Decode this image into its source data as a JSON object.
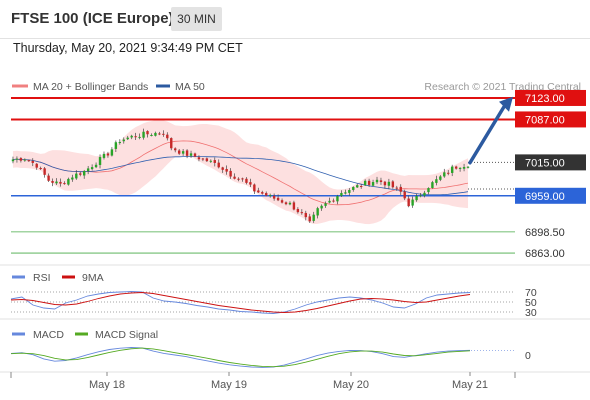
{
  "header": {
    "instrument": "FTSE 100 (ICE Europe)",
    "timeframe": "30 MIN",
    "datetime": "Thursday, May 20, 2021 9:34:49 PM CET"
  },
  "colors": {
    "resistance": "#e01010",
    "support": "#2c64d8",
    "pivot": "#333333",
    "green_level": "#44aa44",
    "band_fill": "#fde0e0",
    "ma20": "#f07070",
    "ma50": "#3060b0",
    "arrow": "#2c5aa0",
    "rsi": "#6688dd",
    "rsi_ma": "#cc1111",
    "macd": "#6688dd",
    "macd_signal": "#55aa22"
  },
  "chart_data": [
    {
      "type": "candlestick",
      "legend": [
        {
          "label": "MA 20 + Bollinger Bands",
          "color": "#f08080"
        },
        {
          "label": "MA 50",
          "color": "#2b5aa0"
        }
      ],
      "copyright": "Research © 2021 Trading Central",
      "ylim": [
        6848,
        7133
      ],
      "x_ticks": [
        "May 18",
        "May 19",
        "May 20",
        "May 21"
      ],
      "levels": [
        {
          "label": "7123.00",
          "value": 7123,
          "kind": "resistance"
        },
        {
          "label": "7087.00",
          "value": 7087,
          "kind": "resistance"
        },
        {
          "label": "7015.00",
          "value": 7015,
          "kind": "pivot"
        },
        {
          "label": "6959.00",
          "value": 6959,
          "kind": "support"
        },
        {
          "label": "6898.50",
          "value": 6898.5,
          "kind": "minor"
        },
        {
          "label": "6863.00",
          "value": 6863,
          "kind": "minor"
        }
      ],
      "anchors": [
        [
          0,
          7020
        ],
        [
          3,
          7022
        ],
        [
          6,
          7010
        ],
        [
          9,
          6985
        ],
        [
          12,
          6978
        ],
        [
          15,
          6992
        ],
        [
          18,
          7000
        ],
        [
          21,
          7015
        ],
        [
          24,
          7030
        ],
        [
          27,
          7052
        ],
        [
          30,
          7058
        ],
        [
          33,
          7062
        ],
        [
          36,
          7064
        ],
        [
          38,
          7066
        ],
        [
          40,
          7040
        ],
        [
          43,
          7030
        ],
        [
          46,
          7025
        ],
        [
          49,
          7018
        ],
        [
          52,
          7010
        ],
        [
          55,
          6995
        ],
        [
          58,
          6985
        ],
        [
          61,
          6968
        ],
        [
          64,
          6960
        ],
        [
          67,
          6952
        ],
        [
          70,
          6945
        ],
        [
          73,
          6928
        ],
        [
          75,
          6912
        ],
        [
          77,
          6935
        ],
        [
          80,
          6950
        ],
        [
          83,
          6965
        ],
        [
          86,
          6972
        ],
        [
          89,
          6980
        ],
        [
          92,
          6985
        ],
        [
          95,
          6978
        ],
        [
          98,
          6965
        ],
        [
          100,
          6945
        ],
        [
          102,
          6955
        ],
        [
          105,
          6975
        ],
        [
          108,
          6990
        ],
        [
          111,
          7005
        ],
        [
          113,
          7010
        ],
        [
          115,
          7012
        ]
      ],
      "candle_count": 116
    },
    {
      "type": "line",
      "name": "RSI",
      "legend": [
        {
          "label": "RSI",
          "color": "#6688dd"
        },
        {
          "label": "9MA",
          "color": "#cc1111"
        }
      ],
      "levels": [
        70,
        50,
        30
      ],
      "level_labels": [
        "70",
        "50",
        "30"
      ],
      "ylim": [
        20,
        80
      ],
      "series": [
        {
          "name": "RSI",
          "values": [
            56,
            60,
            44,
            38,
            36,
            48,
            54,
            62,
            66,
            69,
            70,
            71,
            70,
            58,
            52,
            50,
            47,
            43,
            40,
            36,
            34,
            31,
            30,
            28,
            27,
            30,
            36,
            44,
            50,
            54,
            58,
            60,
            58,
            54,
            48,
            40,
            38,
            46,
            58,
            64,
            66,
            68,
            69
          ]
        },
        {
          "name": "9MA",
          "values": [
            54,
            55,
            53,
            49,
            45,
            44,
            46,
            51,
            57,
            62,
            66,
            68,
            69,
            67,
            63,
            59,
            55,
            51,
            47,
            43,
            40,
            37,
            34,
            32,
            30,
            29,
            30,
            33,
            37,
            42,
            47,
            52,
            56,
            57,
            56,
            54,
            51,
            49,
            50,
            54,
            58,
            62,
            65
          ]
        }
      ]
    },
    {
      "type": "line",
      "name": "MACD",
      "legend": [
        {
          "label": "MACD",
          "color": "#6688dd"
        },
        {
          "label": "MACD Signal",
          "color": "#55aa22"
        }
      ],
      "levels": [
        0
      ],
      "level_labels": [
        "0"
      ],
      "ylim": [
        -1,
        1
      ],
      "series": [
        {
          "name": "MACD",
          "values": [
            0.12,
            0.18,
            0.02,
            -0.3,
            -0.48,
            -0.42,
            -0.22,
            0.02,
            0.25,
            0.42,
            0.52,
            0.58,
            0.55,
            0.3,
            0.12,
            0.0,
            -0.12,
            -0.3,
            -0.45,
            -0.62,
            -0.75,
            -0.85,
            -0.92,
            -0.95,
            -0.92,
            -0.78,
            -0.55,
            -0.3,
            -0.05,
            0.15,
            0.28,
            0.35,
            0.34,
            0.26,
            0.1,
            -0.12,
            -0.18,
            -0.05,
            0.1,
            0.22,
            0.3,
            0.34,
            0.36
          ]
        },
        {
          "name": "MACD Signal",
          "values": [
            0.1,
            0.14,
            0.1,
            -0.05,
            -0.25,
            -0.38,
            -0.35,
            -0.2,
            0.0,
            0.2,
            0.36,
            0.48,
            0.53,
            0.47,
            0.33,
            0.18,
            0.04,
            -0.1,
            -0.25,
            -0.42,
            -0.58,
            -0.7,
            -0.8,
            -0.88,
            -0.9,
            -0.86,
            -0.74,
            -0.55,
            -0.33,
            -0.1,
            0.1,
            0.24,
            0.3,
            0.3,
            0.22,
            0.08,
            -0.04,
            -0.06,
            0.02,
            0.12,
            0.22,
            0.28,
            0.32
          ]
        }
      ]
    }
  ]
}
